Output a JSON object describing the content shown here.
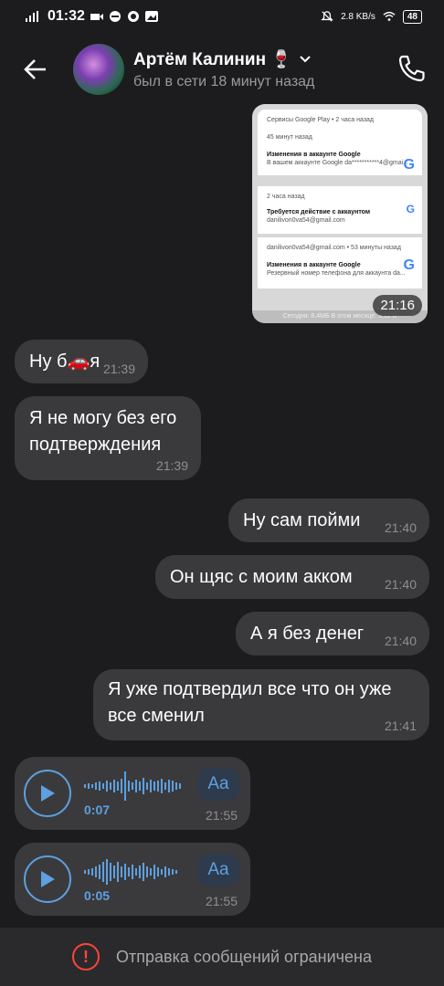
{
  "status_bar": {
    "time": "01:32",
    "network_speed": "2.8 KB/s",
    "battery": "48"
  },
  "header": {
    "name": "Артём Калинин 🍷",
    "status": "был в сети 18 минут назад"
  },
  "screenshot": {
    "app_header": "Сервисы Google Play • 2 часа назад",
    "n1_time": "45 минут назад",
    "n1_title": "Изменения в аккаунте Google",
    "n1_text": "В вашем аккаунте Google da***********4@gmai...",
    "n2_time": "2 часа назад",
    "n2_title": "Требуется действие с аккаунтом",
    "n2_text": "danilivon0va54@gmail.com",
    "n3_time": "danilivon0va54@gmail.com • 53 минуты назад",
    "n3_title": "Изменения в аккаунте Google",
    "n3_text": "Резервный номер телефона для аккаунта da...",
    "footer": "Сегодня: 8,4МБ  В этом месяце: 3,12 В",
    "time": "21:16"
  },
  "messages": [
    {
      "text": "Ну б🚗я",
      "time": "21:39"
    },
    {
      "text": "Я не могу без его подтверждения",
      "time": "21:39"
    },
    {
      "text": "Ну сам пойми",
      "time": "21:40"
    },
    {
      "text": "Он щяс с моим акком",
      "time": "21:40"
    },
    {
      "text": "А я без денег",
      "time": "21:40"
    },
    {
      "text": "Я уже подтвердил все что он уже все сменил",
      "time": "21:41"
    }
  ],
  "voice_messages": [
    {
      "duration": "0:07",
      "transcribe_label": "Aa",
      "time": "21:55"
    },
    {
      "duration": "0:05",
      "transcribe_label": "Aa",
      "time": "21:55"
    }
  ],
  "bottom_bar": {
    "text": "Отправка сообщений ограничена"
  },
  "colors": {
    "background": "#1c1c1e",
    "bubble": "#3a3a3c",
    "accent": "#5ea0e0",
    "warning": "#ff453a"
  },
  "icons": [
    "back-arrow-icon",
    "chevron-down-icon",
    "phone-icon",
    "play-icon",
    "warning-icon",
    "google-icon"
  ]
}
